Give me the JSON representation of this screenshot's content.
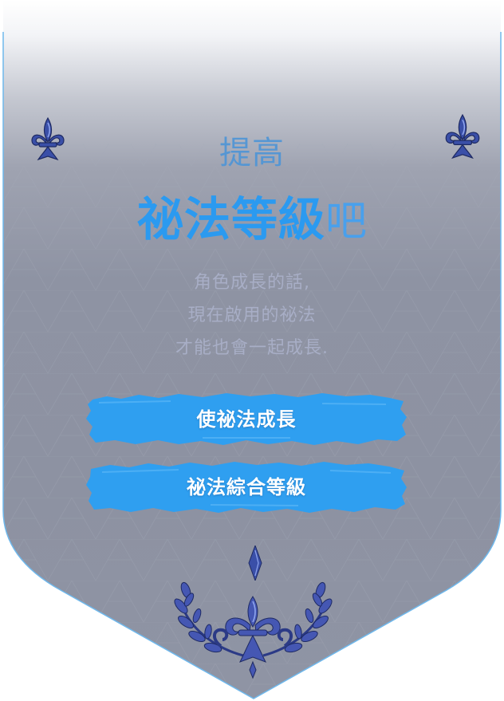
{
  "banner": {
    "title_line1": "提高",
    "title_line2_strong": "祕法等級",
    "title_line2_light": "吧",
    "description": [
      "角色成長的話,",
      "現在啟用的祕法",
      "才能也會一起成長."
    ]
  },
  "buttons": {
    "grow_label": "使祕法成長",
    "total_level_label": "祕法綜合等級"
  },
  "icons": {
    "top_left": "fleur-de-lis-icon",
    "top_right": "fleur-de-lis-icon",
    "bottom_diamond": "diamond-ornament-icon",
    "bottom_crest": "laurel-fleur-crest-icon"
  },
  "colors": {
    "accent_blue": "#2b9af0",
    "button_blue": "#2f9ff0",
    "ornament_blue": "#3a4fa8",
    "banner_border": "#6fb8ec"
  }
}
